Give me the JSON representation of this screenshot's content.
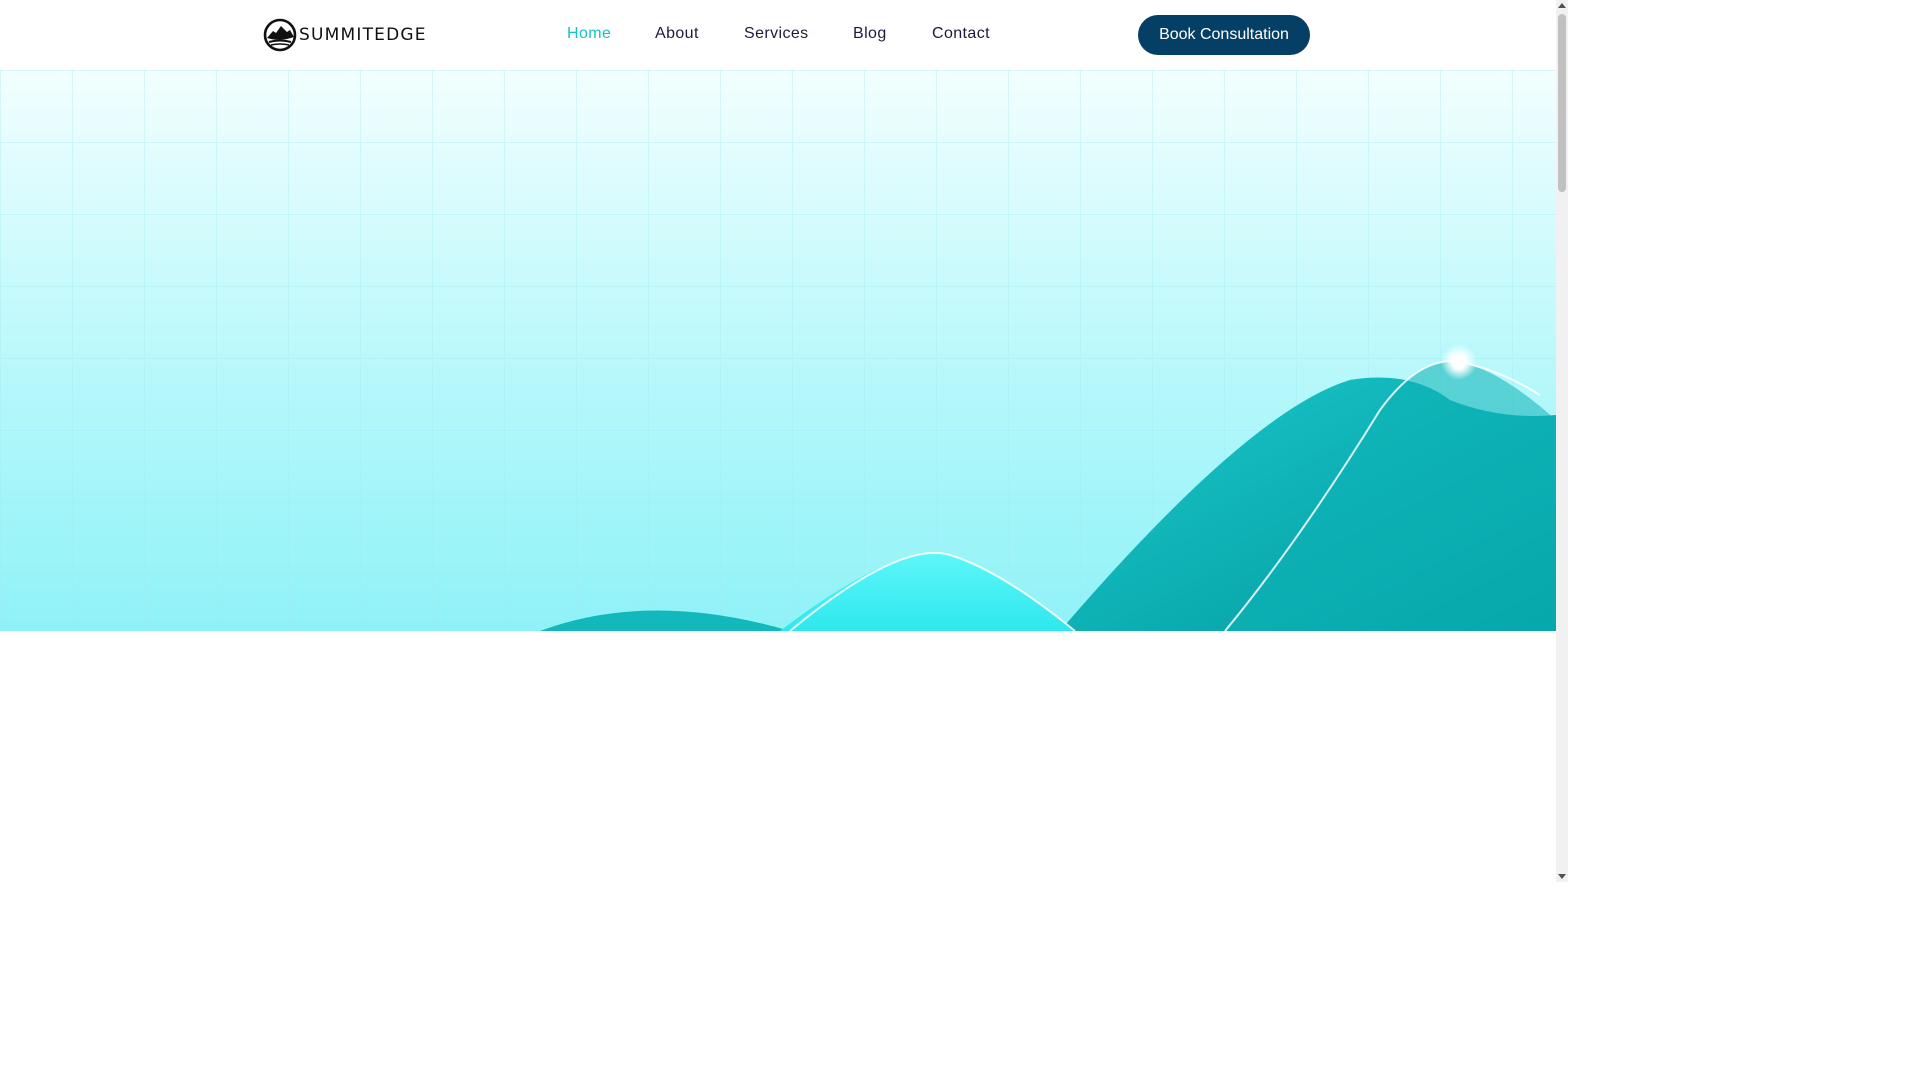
{
  "brand": {
    "name": "SUMMITEDGE",
    "logo_icon": "mountain-circle-icon"
  },
  "nav": {
    "items": [
      {
        "label": "Home",
        "active": true
      },
      {
        "label": "About",
        "active": false
      },
      {
        "label": "Services",
        "active": false
      },
      {
        "label": "Blog",
        "active": false
      },
      {
        "label": "Contact",
        "active": false
      }
    ]
  },
  "cta": {
    "label": "Book Consultation"
  },
  "colors": {
    "accent": "#15c2c4",
    "button_bg": "#053f66",
    "nav_text": "#1c1c3a",
    "hero_wave_dark": "#06a6a9",
    "hero_wave_light": "#3ff0f4"
  }
}
